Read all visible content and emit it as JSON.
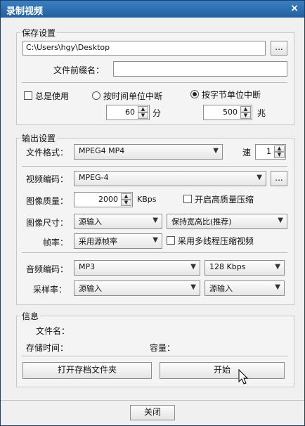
{
  "window": {
    "title": "录制视频",
    "close_glyph": "×"
  },
  "save_settings": {
    "title": "保存设置",
    "path_value": "C:\\Users\\hgy\\Desktop",
    "browse_label": "...",
    "prefix_label": "文件前缀名：",
    "prefix_value": "",
    "always_use_label": "总是使用",
    "always_use_checked": false,
    "split_by_time_label": "按时间单位中断",
    "split_by_size_label": "按字节单位中断",
    "selected_split": "size",
    "time_value": "60",
    "time_unit": "分",
    "size_value": "500",
    "size_unit": "兆"
  },
  "output_settings": {
    "title": "输出设置",
    "format_label": "文件格式：",
    "format_value": "MPEG4 MP4",
    "speed_label": "速",
    "speed_value": "1",
    "video_codec_label": "视频编码：",
    "video_codec_value": "MPEG-4",
    "video_codec_browse": "...",
    "quality_label": "图像质量：",
    "quality_value": "2000",
    "quality_unit": "KBps",
    "hq_compress_label": "开启高质量压缩",
    "hq_compress_checked": false,
    "size_label": "图像尺寸：",
    "size_value": "源输入",
    "aspect_value": "保持宽高比(推荐)",
    "fps_label": "帧率：",
    "fps_value": "采用源帧率",
    "multithread_label": "采用多线程压缩视频",
    "multithread_checked": false,
    "audio_codec_label": "音频编码：",
    "audio_codec_value": "MP3",
    "audio_bitrate_value": "128 Kbps",
    "sample_rate_label": "采样率：",
    "sample_rate_value": "源输入",
    "channels_value": "源输入"
  },
  "info": {
    "title": "信息",
    "filename_label": "文件名：",
    "duration_label": "存储时间：",
    "capacity_label": "容量：",
    "open_folder_label": "打开存档文件夹",
    "start_label": "开始"
  },
  "footer": {
    "close_label": "关闭"
  },
  "icons": {
    "dropdown": "chevron-down-icon",
    "spin_up": "up-arrow-icon",
    "spin_down": "down-arrow-icon",
    "cursor": "mouse-pointer-icon"
  }
}
